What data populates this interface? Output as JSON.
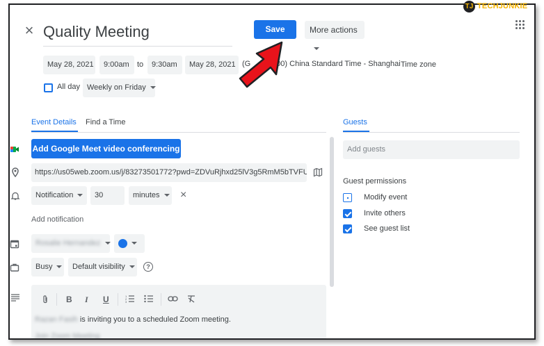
{
  "logo": {
    "mark": "TJ",
    "text": "TECHJUNKIE"
  },
  "event": {
    "title": "Quality Meeting"
  },
  "toolbar": {
    "save_label": "Save",
    "more_actions_label": "More actions"
  },
  "datetime": {
    "start_date": "May 28, 2021",
    "start_time": "9:00am",
    "to_label": "to",
    "end_time": "9:30am",
    "end_date": "May 28, 2021",
    "timezone_prefix": "(G",
    "timezone_suffix": "8:00) China Standard Time - Shanghai",
    "timezone_button": "Time zone",
    "all_day_label": "All day",
    "all_day_checked": false,
    "recurrence": "Weekly on Friday"
  },
  "tabs": [
    {
      "label": "Event Details",
      "active": true
    },
    {
      "label": "Find a Time",
      "active": false
    }
  ],
  "details": {
    "meet_button": "Add Google Meet video conferencing",
    "location_url": "https://us05web.zoom.us/j/83273501772?pwd=ZDVuRjhxd25lV3g5RmM5bTVFUk",
    "notification": {
      "type": "Notification",
      "amount": "30",
      "unit": "minutes"
    },
    "add_notification": "Add notification",
    "calendar_name": "Rosalie Hernandez",
    "calendar_color": "#1a73e8",
    "availability": "Busy",
    "visibility": "Default visibility"
  },
  "description": {
    "sender_name": "Razan Fasih",
    "text": "is inviting you to a scheduled Zoom meeting.",
    "second_line": "Join Zoom Meeting"
  },
  "guests": {
    "tab_label": "Guests",
    "add_placeholder": "Add guests",
    "permissions_title": "Guest permissions",
    "permissions": [
      {
        "label": "Modify event",
        "checked": false
      },
      {
        "label": "Invite others",
        "checked": true
      },
      {
        "label": "See guest list",
        "checked": true
      }
    ]
  },
  "colors": {
    "accent": "#1a73e8",
    "chip_bg": "#f1f3f4",
    "arrow": "#e8131b",
    "logo": "#f5b400"
  }
}
